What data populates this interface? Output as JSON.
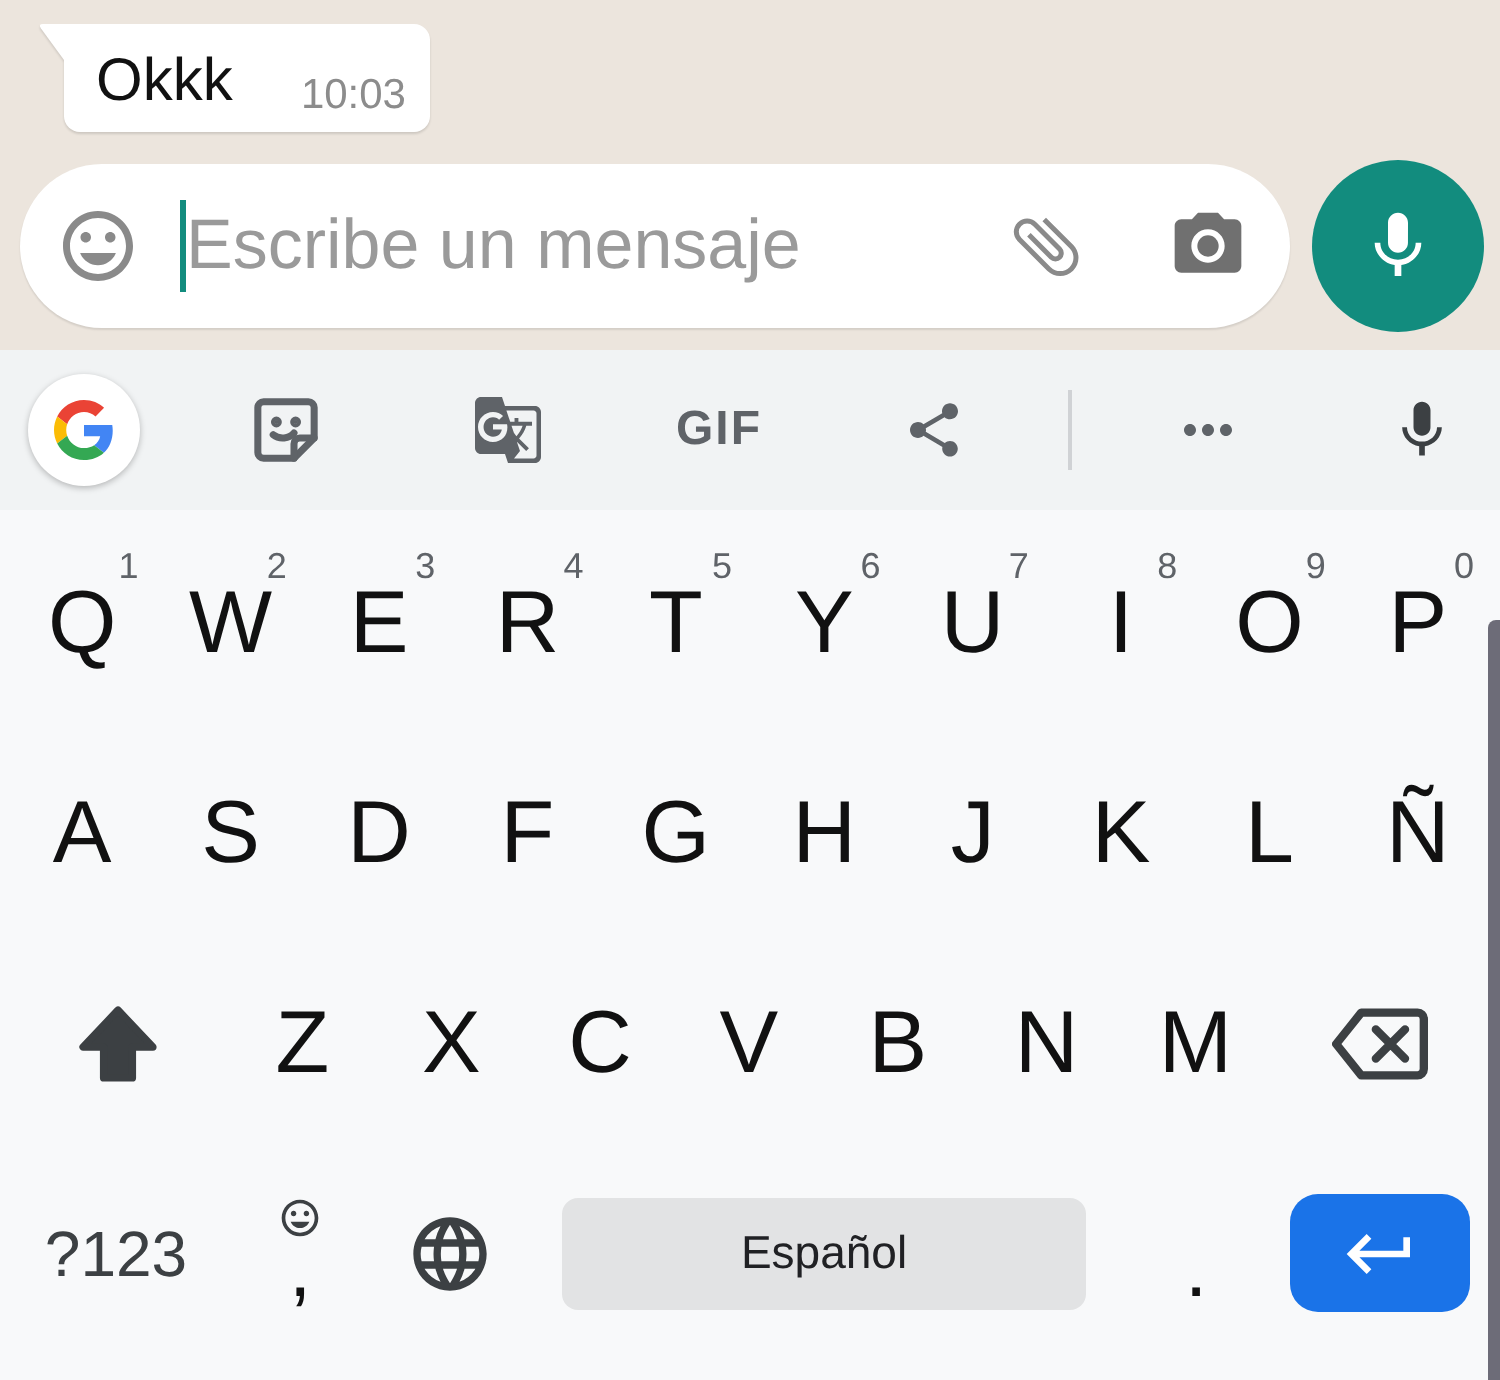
{
  "chat": {
    "messages": [
      {
        "text": "Okkk",
        "time": "10:03"
      }
    ]
  },
  "composer": {
    "placeholder": "Escribe un mensaje"
  },
  "keyboard": {
    "toolbar": [
      {
        "kind": "google"
      },
      {
        "kind": "sticker"
      },
      {
        "kind": "translate"
      },
      {
        "kind": "gif",
        "label": "GIF"
      },
      {
        "kind": "share"
      },
      {
        "kind": "divider"
      },
      {
        "kind": "more"
      },
      {
        "kind": "voice"
      }
    ],
    "letter_rows": [
      [
        {
          "kind": "letter",
          "label": "Q",
          "hint": "1"
        },
        {
          "kind": "letter",
          "label": "W",
          "hint": "2"
        },
        {
          "kind": "letter",
          "label": "E",
          "hint": "3"
        },
        {
          "kind": "letter",
          "label": "R",
          "hint": "4"
        },
        {
          "kind": "letter",
          "label": "T",
          "hint": "5"
        },
        {
          "kind": "letter",
          "label": "Y",
          "hint": "6"
        },
        {
          "kind": "letter",
          "label": "U",
          "hint": "7"
        },
        {
          "kind": "letter",
          "label": "I",
          "hint": "8"
        },
        {
          "kind": "letter",
          "label": "O",
          "hint": "9"
        },
        {
          "kind": "letter",
          "label": "P",
          "hint": "0"
        }
      ],
      [
        {
          "kind": "letter",
          "label": "A"
        },
        {
          "kind": "letter",
          "label": "S"
        },
        {
          "kind": "letter",
          "label": "D"
        },
        {
          "kind": "letter",
          "label": "F"
        },
        {
          "kind": "letter",
          "label": "G"
        },
        {
          "kind": "letter",
          "label": "H"
        },
        {
          "kind": "letter",
          "label": "J"
        },
        {
          "kind": "letter",
          "label": "K"
        },
        {
          "kind": "letter",
          "label": "L"
        },
        {
          "kind": "letter",
          "label": "Ñ"
        }
      ],
      [
        {
          "kind": "shift",
          "on": true
        },
        {
          "kind": "letter",
          "label": "Z"
        },
        {
          "kind": "letter",
          "label": "X"
        },
        {
          "kind": "letter",
          "label": "C"
        },
        {
          "kind": "letter",
          "label": "V"
        },
        {
          "kind": "letter",
          "label": "B"
        },
        {
          "kind": "letter",
          "label": "N"
        },
        {
          "kind": "letter",
          "label": "M"
        },
        {
          "kind": "backspace"
        }
      ]
    ],
    "bottom_row": [
      {
        "kind": "symbols",
        "label": "?123"
      },
      {
        "kind": "comma",
        "label": ","
      },
      {
        "kind": "globe"
      },
      {
        "kind": "space",
        "label": "Español"
      },
      {
        "kind": "period",
        "label": "."
      },
      {
        "kind": "enter"
      }
    ]
  }
}
